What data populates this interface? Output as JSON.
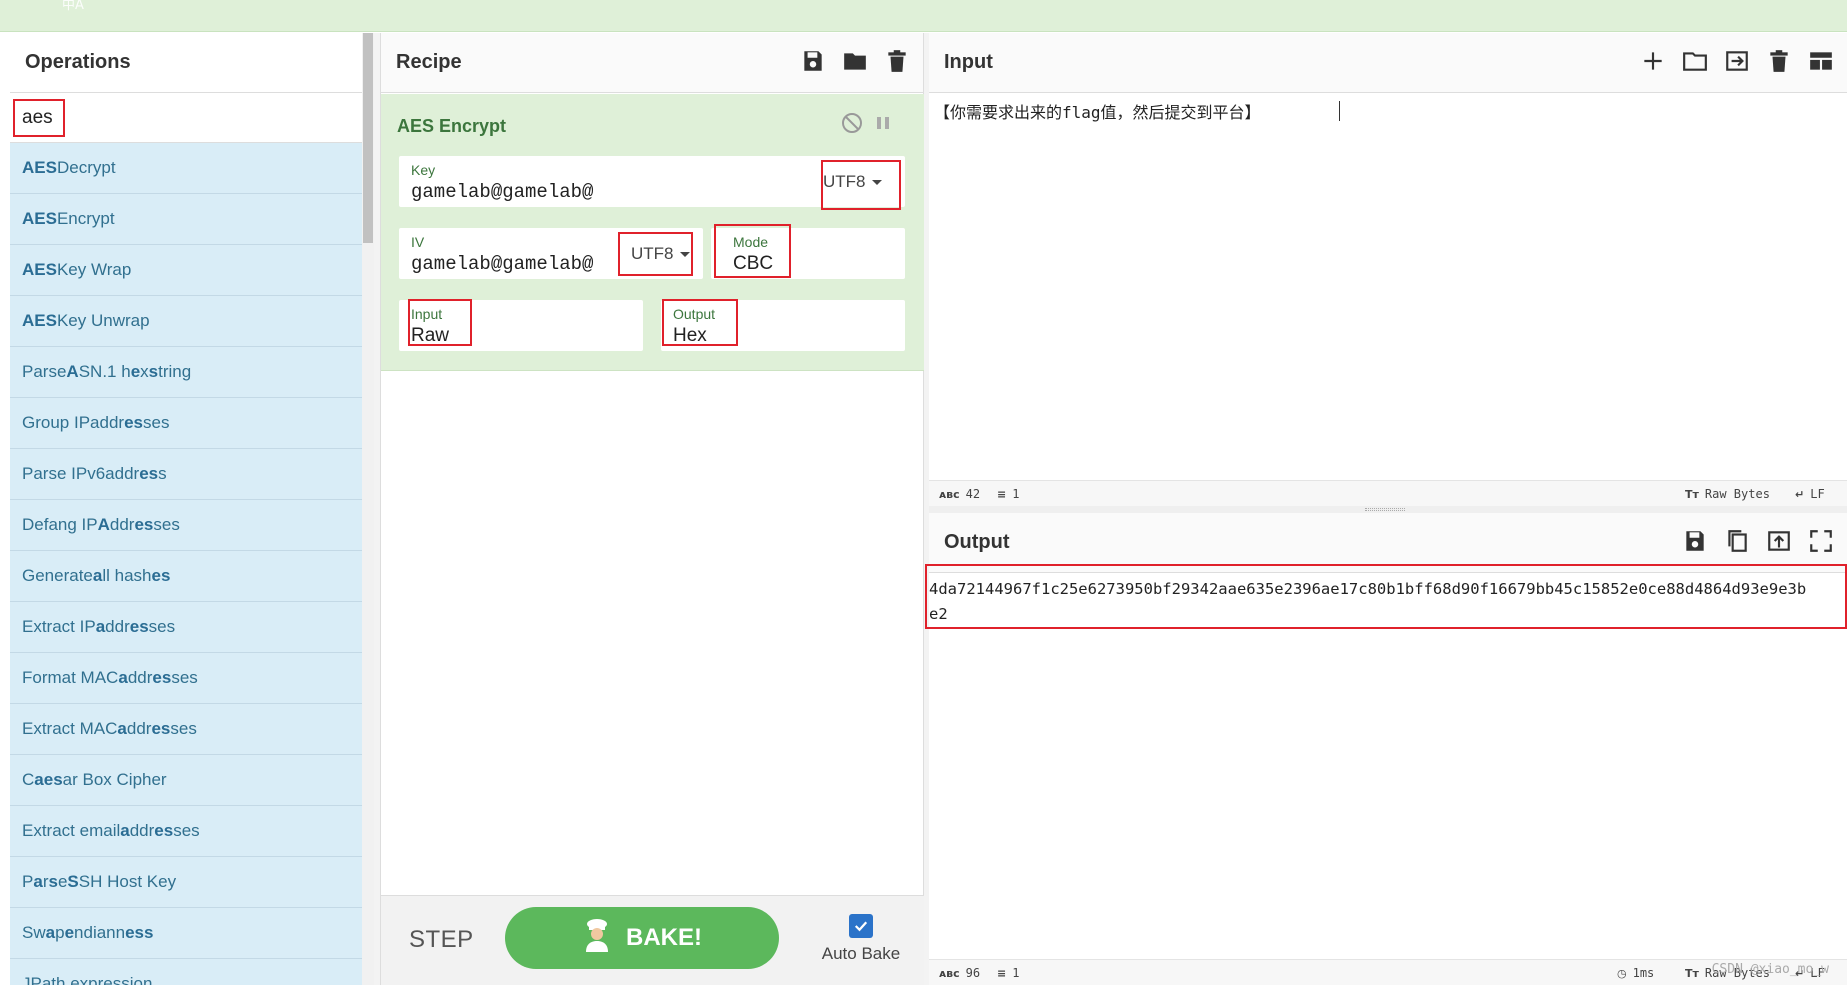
{
  "topbar": {
    "lang_glyph": "中A"
  },
  "operations": {
    "title": "Operations",
    "search_value": "aes",
    "items": [
      {
        "pre": "",
        "b": "AES",
        "post": " Decrypt"
      },
      {
        "pre": "",
        "b": "AES",
        "post": " Encrypt"
      },
      {
        "pre": "",
        "b": "AES",
        "post": " Key Wrap"
      },
      {
        "pre": "",
        "b": "AES",
        "post": " Key Unwrap"
      },
      {
        "pre": "Parse ",
        "b": "A",
        "post": "SN.1 h",
        "b2": "e",
        "post2": "x ",
        "b3": "s",
        "post3": "tring"
      },
      {
        "pre": "Group IP ",
        "b": "",
        "post": "addr",
        "b2": "es",
        "post2": "ses"
      },
      {
        "pre": "Parse IPv6 ",
        "b": "",
        "post": "addr",
        "b2": "es",
        "post2": "s"
      },
      {
        "pre": "Defang IP ",
        "b": "A",
        "post": "ddr",
        "b2": "es",
        "post2": "ses"
      },
      {
        "pre": "Generate ",
        "b": "a",
        "post": "ll hash",
        "b2": "es",
        "post2": ""
      },
      {
        "pre": "Extract IP ",
        "b": "a",
        "post": "ddr",
        "b2": "es",
        "post2": "ses"
      },
      {
        "pre": "Format MAC ",
        "b": "a",
        "post": "ddr",
        "b2": "es",
        "post2": "ses"
      },
      {
        "pre": "Extract MAC ",
        "b": "a",
        "post": "ddr",
        "b2": "es",
        "post2": "ses"
      },
      {
        "pre": "C",
        "b": "aes",
        "post": "ar Box Cipher"
      },
      {
        "pre": "Extract email ",
        "b": "a",
        "post": "ddr",
        "b2": "es",
        "post2": "ses"
      },
      {
        "pre": "P",
        "b": "a",
        "post": "r",
        "b2": "s",
        "post2": "e ",
        "b3": "S",
        "post3": "SH Host Key"
      },
      {
        "pre": "Sw",
        "b": "a",
        "post": "p ",
        "b2": "e",
        "post2": "ndiann",
        "b3": "ess",
        "post3": ""
      },
      {
        "pre": "",
        "b": "",
        "post": "JPath expression"
      }
    ]
  },
  "recipe": {
    "title": "Recipe",
    "operation": {
      "name": "AES Encrypt",
      "key_label": "Key",
      "key_value": "gamelab@gamelab@",
      "key_encoding": "UTF8",
      "iv_label": "IV",
      "iv_value": "gamelab@gamelab@",
      "iv_encoding": "UTF8",
      "mode_label": "Mode",
      "mode_value": "CBC",
      "input_label": "Input",
      "input_value": "Raw",
      "output_label": "Output",
      "output_value": "Hex"
    },
    "step_label": "STEP",
    "bake_label": "BAKE!",
    "auto_bake_label": "Auto Bake"
  },
  "input": {
    "title": "Input",
    "text": "【你需要求出来的flag值，然后提交到平台】",
    "status_length": "42",
    "status_lines": "1",
    "status_encoding": "Raw Bytes",
    "status_eol": "LF"
  },
  "output": {
    "title": "Output",
    "line1": "4da72144967f1c25e6273950bf29342aae635e2396ae17c80b1bff68d90f16679bb45c15852e0ce88d4864d93e9e3b",
    "line2": "e2",
    "status_length": "96",
    "status_lines": "1",
    "status_time": "1ms",
    "status_encoding": "Raw Bytes",
    "status_eol": "LF",
    "watermark": "CSDN @xiao_mo_w"
  },
  "colors": {
    "accent_green": "#5cb85c",
    "card_green": "#dff0d8",
    "ops_blue": "#d9edf7",
    "highlight_red": "#e0212b"
  }
}
